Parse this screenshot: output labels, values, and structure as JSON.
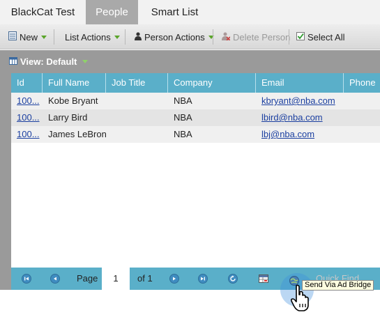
{
  "tabs": [
    {
      "label": "BlackCat Test"
    },
    {
      "label": "People"
    },
    {
      "label": "Smart List"
    }
  ],
  "toolbar": {
    "new_label": "New",
    "list_actions_label": "List Actions",
    "person_actions_label": "Person Actions",
    "delete_person_label": "Delete Person",
    "select_all_label": "Select All"
  },
  "view": {
    "label": "View: Default"
  },
  "grid": {
    "columns": [
      "Id",
      "Full Name",
      "Job Title",
      "Company",
      "Email",
      "Phone"
    ],
    "rows": [
      {
        "id": "100...",
        "full_name": "Kobe Bryant",
        "job_title": "",
        "company": "NBA",
        "email": "kbryant@nba.com",
        "phone": ""
      },
      {
        "id": "100...",
        "full_name": "Larry Bird",
        "job_title": "",
        "company": "NBA",
        "email": "lbird@nba.com",
        "phone": ""
      },
      {
        "id": "100...",
        "full_name": "James LeBron",
        "job_title": "",
        "company": "NBA",
        "email": "lbj@nba.com",
        "phone": ""
      }
    ]
  },
  "pager": {
    "page_label": "Page",
    "page_value": "1",
    "of_label": "of 1",
    "quick_find": "Quick Find"
  },
  "tooltip": {
    "text": "Send Via Ad Bridge"
  },
  "colors": {
    "accent": "#5aafc9",
    "tab_active": "#a9a9a9",
    "link": "#1b3fa0"
  }
}
